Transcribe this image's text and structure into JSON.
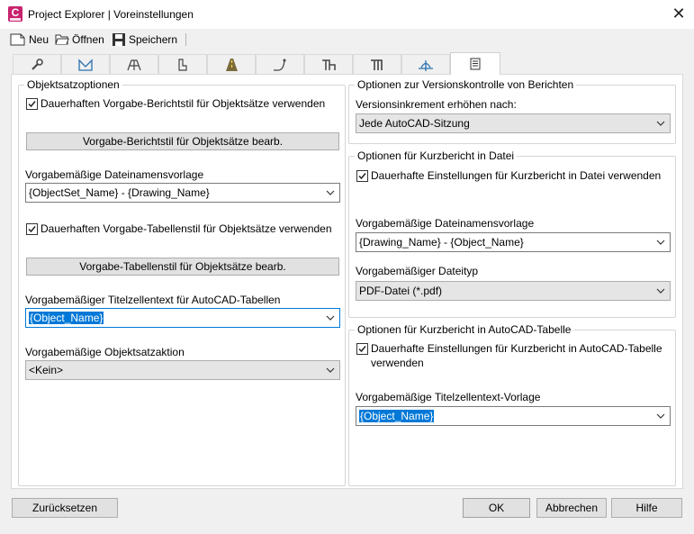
{
  "window": {
    "title": "Project Explorer | Voreinstellungen",
    "app_icon_letter": "C",
    "close_glyph": "✕"
  },
  "toolbar": {
    "new_label": "Neu",
    "open_label": "Öffnen",
    "save_label": "Speichern"
  },
  "tabs": [
    {
      "icon": "wrench-icon"
    },
    {
      "icon": "site-icon"
    },
    {
      "icon": "grading-icon"
    },
    {
      "icon": "parcel-icon"
    },
    {
      "icon": "road-icon"
    },
    {
      "icon": "alignment-icon"
    },
    {
      "icon": "pipe-network-icon"
    },
    {
      "icon": "pressure-pipe-icon"
    },
    {
      "icon": "profile-icon"
    },
    {
      "icon": "report-icon",
      "active": true
    }
  ],
  "objectset": {
    "title": "Objektsatzoptionen",
    "persistent_report_style_label": "Dauerhaften Vorgabe-Berichtstil für Objektsätze verwenden",
    "persistent_report_style_checked": true,
    "edit_report_style_button": "Vorgabe-Berichtstil für Objektsätze bearb.",
    "filename_template_label": "Vorgabemäßige Dateinamensvorlage",
    "filename_template_value": "{ObjectSet_Name} - {Drawing_Name}",
    "persistent_table_style_label": "Dauerhaften Vorgabe-Tabellenstil für Objektsätze verwenden",
    "persistent_table_style_checked": true,
    "edit_table_style_button": "Vorgabe-Tabellenstil für Objektsätze bearb.",
    "title_cell_label": "Vorgabemäßiger Titelzellentext für AutoCAD-Tabellen",
    "title_cell_value": "{Object_Name}",
    "action_label": "Vorgabemäßige Objektsatzaktion",
    "action_value": "<Kein>"
  },
  "version": {
    "title": "Optionen zur Versionskontrolle von Berichten",
    "increment_label": "Versionsinkrement erhöhen nach:",
    "increment_value": "Jede AutoCAD-Sitzung"
  },
  "file_report": {
    "title": "Optionen für Kurzbericht in Datei",
    "persistent_label": "Dauerhafte Einstellungen für Kurzbericht in Datei verwenden",
    "persistent_checked": true,
    "filename_template_label": "Vorgabemäßige Dateinamensvorlage",
    "filename_template_value": "{Drawing_Name} - {Object_Name}",
    "filetype_label": "Vorgabemäßiger Dateityp",
    "filetype_value": "PDF-Datei (*.pdf)"
  },
  "table_report": {
    "title": "Optionen für Kurzbericht in AutoCAD-Tabelle",
    "persistent_label_line1": "Dauerhafte Einstellungen für Kurzbericht in AutoCAD-Tabelle",
    "persistent_label_line2": "verwenden",
    "persistent_checked": true,
    "title_template_label": "Vorgabemäßige Titelzellentext-Vorlage",
    "title_template_value": "{Object_Name}"
  },
  "buttons": {
    "reset": "Zurücksetzen",
    "ok": "OK",
    "cancel": "Abbrechen",
    "help": "Hilfe"
  },
  "colors": {
    "accent": "#0078d7",
    "app_icon": "#c8236f"
  }
}
